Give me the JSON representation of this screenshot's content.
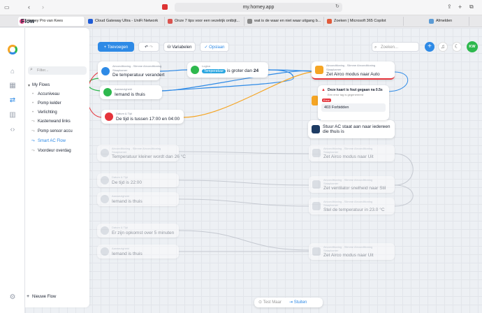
{
  "browser": {
    "url": "my.homey.app"
  },
  "bookmarks": [
    {
      "label": "Homey Pro van Kees",
      "color": "#e04a8a"
    },
    {
      "label": "Cloud Gateway Ultra - UniFi Network",
      "color": "#1e5bd6"
    },
    {
      "label": "Onze 7 tips voor een vezelrijk ontbijt...",
      "color": "#d9534f"
    },
    {
      "label": "wat is de waar en niet waar uitgang b...",
      "color": "#888888"
    },
    {
      "label": "Zoeken | Microsoft 365 Copilot",
      "color": "#e05a3a"
    },
    {
      "label": "Afmelden",
      "color": "#5b9bd5"
    }
  ],
  "app": {
    "name": "Flow"
  },
  "toolbar": {
    "add": "+ Toevoegen",
    "variables": "Variabelen",
    "save": "Opslaan",
    "search_placeholder": "Zoeken...",
    "avatar": "KW"
  },
  "sidebar": {
    "filter_placeholder": "Filter...",
    "root": "My Flows",
    "items": [
      "Accuniveau",
      "Pomp kelder",
      "Verlichting",
      "Kastenwand links",
      "Pomp sensor accu",
      "Smart AC Flow",
      "Voordeur overdag"
    ],
    "new_flow": "Nieuwe Flow"
  },
  "cards": {
    "c1": {
      "small": "Airconditioning - Slimme Airconditioning",
      "small2": "Slaapkamer",
      "text": "De temperatuur verandert"
    },
    "c2": {
      "small": "Logica",
      "token": "Temperatuur",
      "text": "is groter dan",
      "value": "24"
    },
    "c3": {
      "small": "Aanwezigheid",
      "text": "Iemand is thuis"
    },
    "c4": {
      "small": "Datum & Tijd",
      "text": "De tijd is tussen 17:00 en 04:00"
    },
    "c5": {
      "small": "Airconditioning - Slimme Airconditioning",
      "small2": "Slaapkamer",
      "text": "Zet Airco modus naar Auto"
    },
    "c6": {
      "text": "Stuur AC staat aan naar iedereen die thuis is"
    },
    "d1": {
      "small": "Airconditioning - Slimme Airconditioning",
      "small2": "Slaapkamer",
      "text": "Temperatuur kleiner wordt dan 26 °C"
    },
    "d2": {
      "small": "Datum & Tijd",
      "text": "De tijd is 22:00"
    },
    "d3": {
      "small": "Aanwezigheid",
      "text": "Iemand is thuis"
    },
    "d4": {
      "small": "Datum & Tijd",
      "text": "Er zijn opkomst over 5 minuten"
    },
    "d5": {
      "small": "Aanwezigheid",
      "text": "Iemand is thuis"
    },
    "d6": {
      "small": "Airconditioning - Slimme Airconditioning",
      "small2": "Slaapkamer",
      "text": "Zet Airco modus naar Uit"
    },
    "d7": {
      "small": "Airconditioning - Slimme Airconditioning",
      "small2": "Slaapkamer",
      "text": "Zet ventilator snelheid naar Stil"
    },
    "d8": {
      "small": "Airconditioning - Slimme Airconditioning",
      "small2": "Slaapkamer",
      "text": "Stel de temperatuur in 23.0 °C"
    },
    "d9": {
      "small": "Airconditioning - Slimme Airconditioning",
      "small2": "Slaapkamer",
      "text": "Zet Airco modus naar Uit"
    }
  },
  "error": {
    "title": "Deze kaart is fout gegaan na 0.5s",
    "sub": "Een error tag is gegenereerd",
    "tag": "Error",
    "message": "403 Forbidden"
  },
  "bottom": {
    "test": "Test Maar",
    "stop": "Stuiten"
  },
  "colors": {
    "accent": "#2e8ae6",
    "orange": "#f5a524",
    "green": "#2db84d",
    "red": "#e5343b"
  }
}
